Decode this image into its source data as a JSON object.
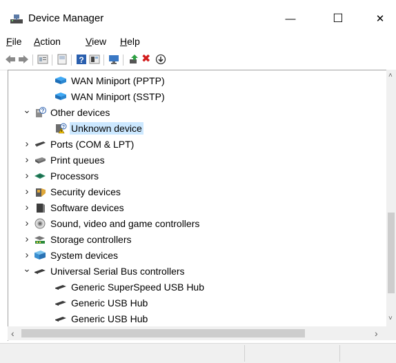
{
  "window": {
    "title": "Device Manager",
    "minimize_glyph": "—",
    "maximize_glyph": "☐",
    "close_glyph": "✕"
  },
  "menu": [
    {
      "accel": "F",
      "rest": "ile"
    },
    {
      "accel": "A",
      "rest": "ction"
    },
    {
      "accel": "V",
      "rest": "iew"
    },
    {
      "accel": "H",
      "rest": "elp"
    }
  ],
  "toolbar": {
    "icons": [
      "back-icon",
      "forward-icon",
      "properties-icon",
      "show-hidden-icon",
      "help-icon",
      "details-icon",
      "scan-hardware-icon",
      "update-driver-icon",
      "uninstall-icon",
      "disable-icon"
    ],
    "uninstall_glyph": "✖",
    "disable_glyph": "⬇"
  },
  "tree": [
    {
      "label": "WAN Miniport (PPTP)",
      "level": 2,
      "expander": "",
      "icon": "network-adapter-icon"
    },
    {
      "label": "WAN Miniport (SSTP)",
      "level": 2,
      "expander": "",
      "icon": "network-adapter-icon"
    },
    {
      "label": "Other devices",
      "level": 1,
      "expander": "⌄",
      "icon": "other-devices-icon"
    },
    {
      "label": "Unknown device",
      "level": 2,
      "expander": "",
      "icon": "unknown-device-warning-icon",
      "selected": true
    },
    {
      "label": "Ports (COM & LPT)",
      "level": 1,
      "expander": "›",
      "icon": "port-icon"
    },
    {
      "label": "Print queues",
      "level": 1,
      "expander": "›",
      "icon": "printer-icon"
    },
    {
      "label": "Processors",
      "level": 1,
      "expander": "›",
      "icon": "processor-icon"
    },
    {
      "label": "Security devices",
      "level": 1,
      "expander": "›",
      "icon": "security-device-icon"
    },
    {
      "label": "Software devices",
      "level": 1,
      "expander": "›",
      "icon": "software-device-icon"
    },
    {
      "label": "Sound, video and game controllers",
      "level": 1,
      "expander": "›",
      "icon": "speaker-icon"
    },
    {
      "label": "Storage controllers",
      "level": 1,
      "expander": "›",
      "icon": "storage-controller-icon"
    },
    {
      "label": "System devices",
      "level": 1,
      "expander": "›",
      "icon": "system-device-icon"
    },
    {
      "label": "Universal Serial Bus controllers",
      "level": 1,
      "expander": "⌄",
      "icon": "usb-icon"
    },
    {
      "label": "Generic SuperSpeed USB Hub",
      "level": 2,
      "expander": "",
      "icon": "usb-icon"
    },
    {
      "label": "Generic USB Hub",
      "level": 2,
      "expander": "",
      "icon": "usb-icon"
    },
    {
      "label": "Generic USB Hub",
      "level": 2,
      "expander": "",
      "icon": "usb-icon"
    }
  ],
  "scroll": {
    "up": "˄",
    "down": "˅",
    "left": "‹",
    "right": "›"
  }
}
